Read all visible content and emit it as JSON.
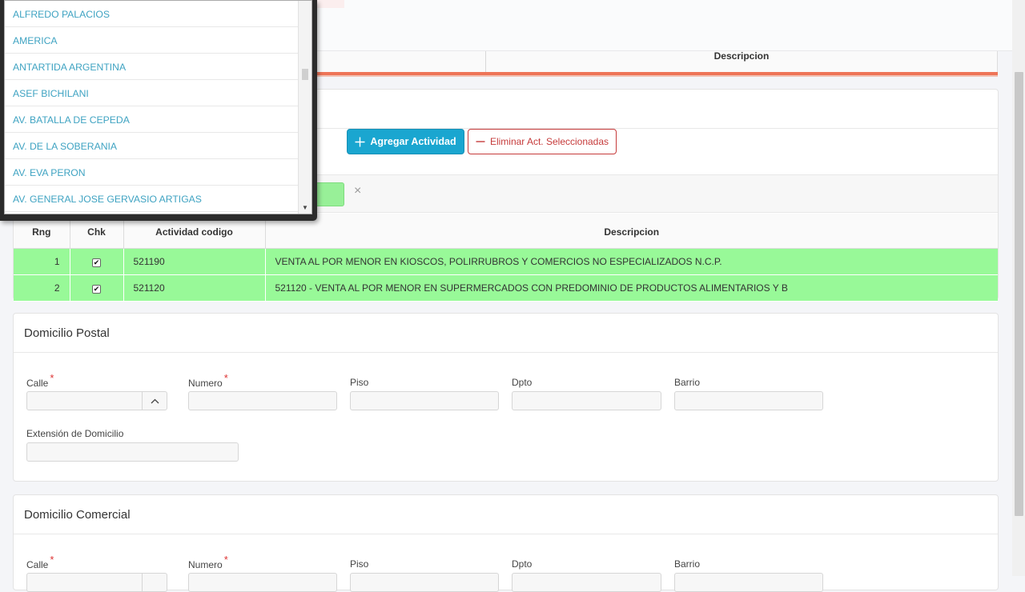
{
  "top_table": {
    "col_descripcion": "Descripcion"
  },
  "dropdown": {
    "items": [
      "ALFREDO PALACIOS",
      "AMERICA",
      "ANTARTIDA ARGENTINA",
      "ASEF BICHILANI",
      "AV. BATALLA DE CEPEDA",
      "AV. DE LA SOBERANIA",
      "AV. EVA PERON",
      "AV. GENERAL JOSE GERVASIO ARTIGAS"
    ]
  },
  "activities": {
    "add_button": "Agregar Actividad",
    "delete_button": "Eliminar Act. Seleccionadas",
    "clear_icon": "×",
    "headers": {
      "rng": "Rng",
      "chk": "Chk",
      "codigo": "Actividad codigo",
      "descripcion": "Descripcion"
    },
    "rows": [
      {
        "rng": "1",
        "checked": true,
        "codigo": "521190",
        "descripcion": "VENTA AL POR MENOR EN KIOSCOS, POLIRRUBROS Y COMERCIOS NO ESPECIALIZADOS N.C.P."
      },
      {
        "rng": "2",
        "checked": true,
        "codigo": "521120",
        "descripcion": "521120 - VENTA AL POR MENOR EN SUPERMERCADOS CON PREDOMINIO DE PRODUCTOS ALIMENTARIOS Y B"
      }
    ],
    "row_color": "#98f998"
  },
  "postal": {
    "title": "Domicilio Postal",
    "calle": "Calle",
    "numero": "Numero",
    "piso": "Piso",
    "dpto": "Dpto",
    "barrio": "Barrio",
    "extension": "Extensión de Domicilio"
  },
  "comercial": {
    "title": "Domicilio Comercial",
    "calle": "Calle",
    "numero": "Numero",
    "piso": "Piso",
    "dpto": "Dpto",
    "barrio": "Barrio"
  },
  "colors": {
    "accent": "#1aa6d0",
    "danger": "#c63b3b",
    "link": "#3fa3c2",
    "tab_underline": "#ee7457"
  }
}
